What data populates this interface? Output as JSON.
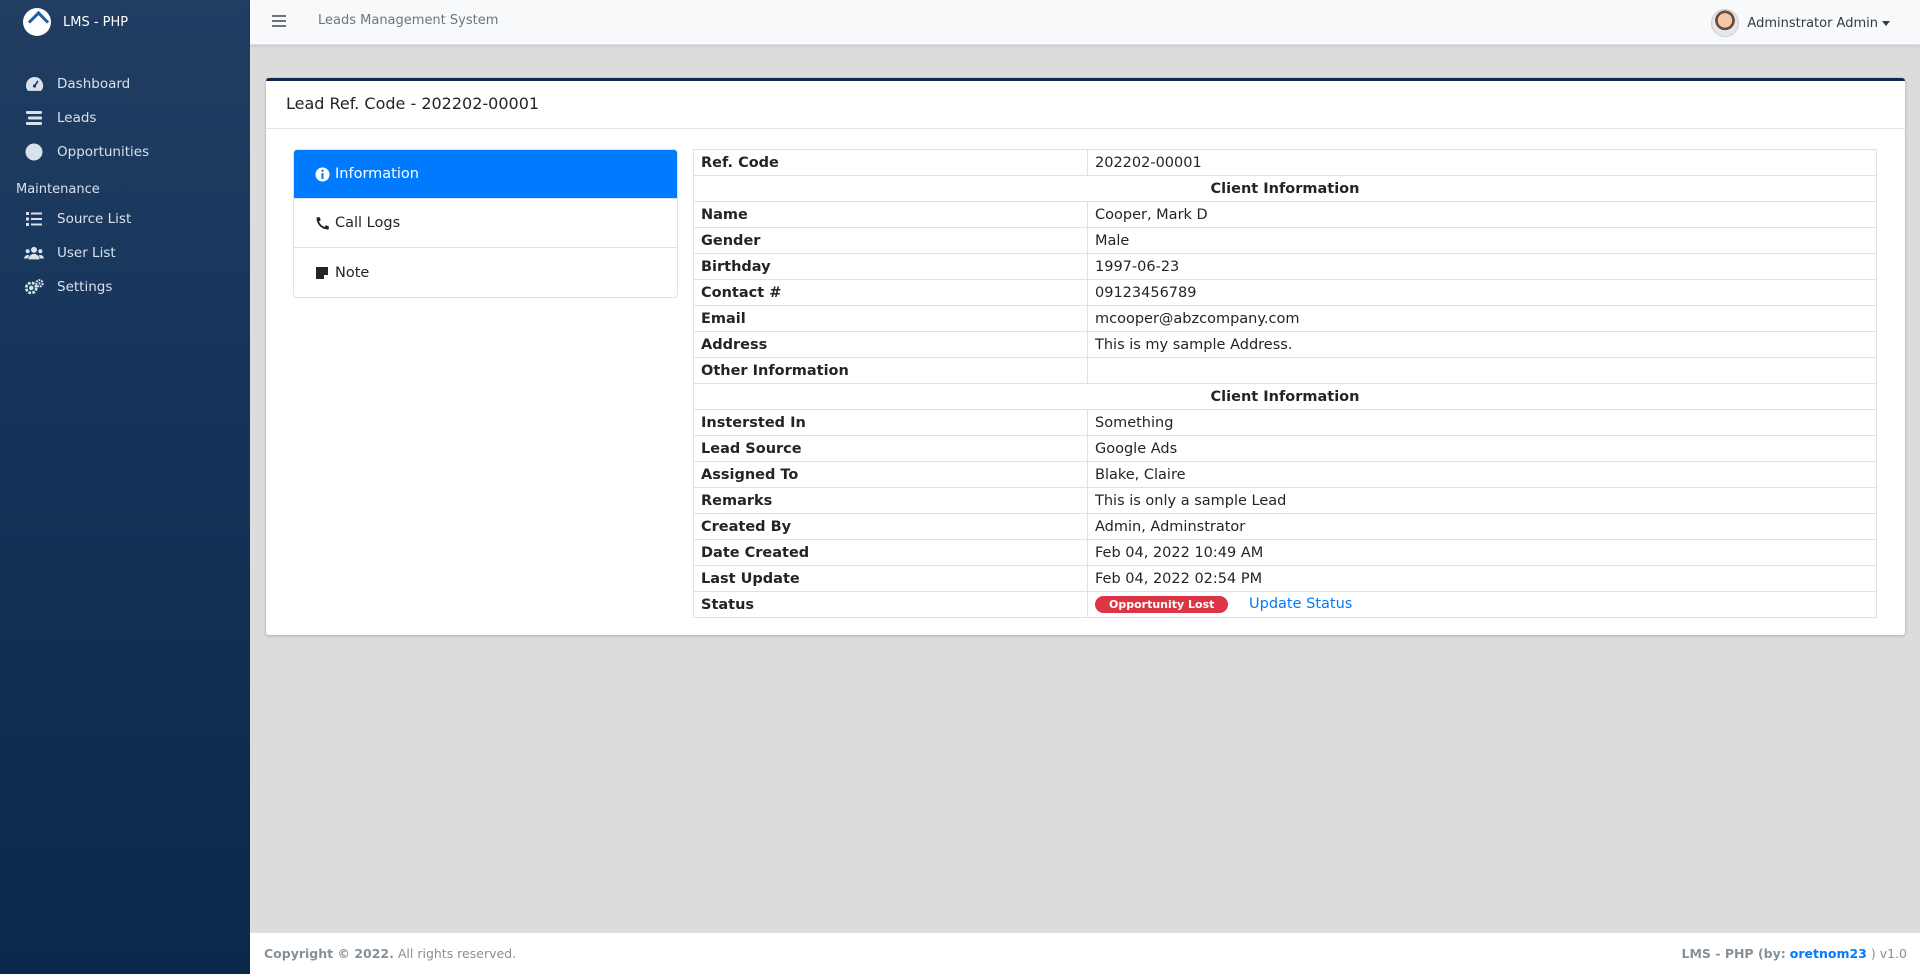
{
  "brand": {
    "name": "LMS - PHP"
  },
  "sidebar": {
    "items": [
      {
        "label": "Dashboard",
        "icon": "dashboard-icon"
      },
      {
        "label": "Leads",
        "icon": "leads-icon"
      },
      {
        "label": "Opportunities",
        "icon": "circle-icon"
      }
    ],
    "maintenance_header": "Maintenance",
    "maintenance_items": [
      {
        "label": "Source List",
        "icon": "list-icon"
      },
      {
        "label": "User List",
        "icon": "users-icon"
      },
      {
        "label": "Settings",
        "icon": "cogs-icon"
      }
    ]
  },
  "topbar": {
    "system_title": "Leads Management System",
    "user_name": "Adminstrator Admin"
  },
  "card": {
    "title": "Lead Ref. Code - 202202-00001"
  },
  "tabs": [
    {
      "label": "Information",
      "icon": "info-icon",
      "active": true
    },
    {
      "label": "Call Logs",
      "icon": "phone-icon",
      "active": false
    },
    {
      "label": "Note",
      "icon": "note-icon",
      "active": false
    }
  ],
  "info": {
    "ref_code_label": "Ref. Code",
    "ref_code": "202202-00001",
    "client_section": "Client Information",
    "name_label": "Name",
    "name": "Cooper, Mark D",
    "gender_label": "Gender",
    "gender": "Male",
    "birthday_label": "Birthday",
    "birthday": "1997-06-23",
    "contact_label": "Contact #",
    "contact": "09123456789",
    "email_label": "Email",
    "email": "mcooper@abzcompany.com",
    "address_label": "Address",
    "address": "This is my sample Address.",
    "other_label": "Other Information",
    "other": "",
    "lead_section": "Client Information",
    "interested_label": "Instersted In",
    "interested": "Something",
    "source_label": "Lead Source",
    "source": "Google Ads",
    "assigned_label": "Assigned To",
    "assigned": "Blake, Claire",
    "remarks_label": "Remarks",
    "remarks": "This is only a sample Lead",
    "created_by_label": "Created By",
    "created_by": "Admin, Adminstrator",
    "date_created_label": "Date Created",
    "date_created": "Feb 04, 2022 10:49 AM",
    "last_update_label": "Last Update",
    "last_update": "Feb 04, 2022 02:54 PM",
    "status_label": "Status",
    "status_badge": "Opportunity Lost",
    "status_color": "#dc3545",
    "update_status": "Update Status"
  },
  "footer": {
    "copyright": "Copyright © 2022.",
    "rights": "All rights reserved.",
    "right_prefix": "LMS - PHP (by:",
    "author": "oretnom23",
    "right_suffix": ") v1.0"
  }
}
